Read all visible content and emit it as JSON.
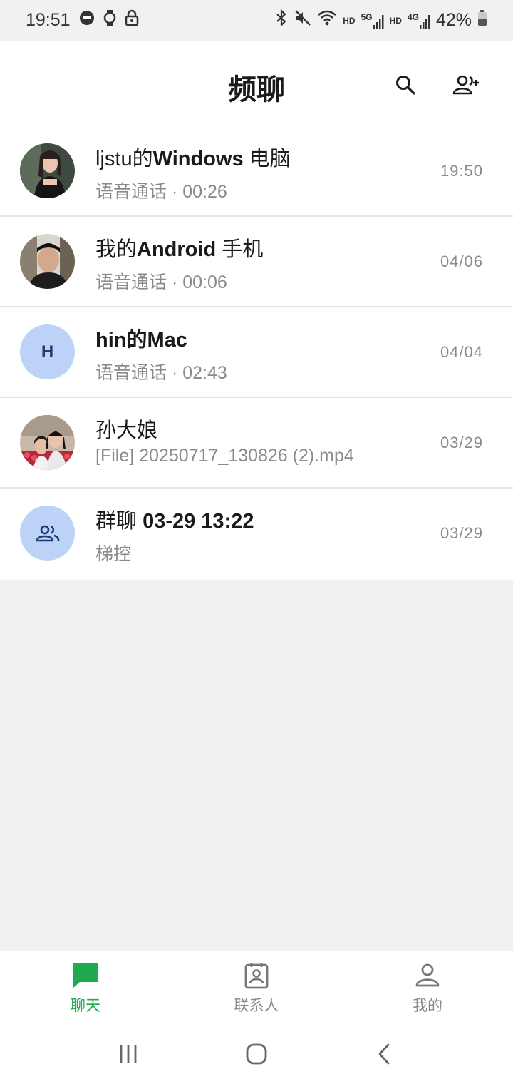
{
  "status_bar": {
    "time": "19:51",
    "left_icons": [
      "wear-icon",
      "watch-icon",
      "lock-icon"
    ],
    "network_hd1": "HD",
    "network_5g": "5G",
    "network_hd2": "HD",
    "network_4g": "4G",
    "battery": "42%"
  },
  "header": {
    "title": "频聊",
    "search_icon": "search-icon",
    "add_contact_icon": "add-contact-icon"
  },
  "chats": [
    {
      "avatar_type": "photo",
      "name_prefix": "ljstu的",
      "name_bold": "Windows",
      "name_suffix": " 电脑",
      "subtitle": "语音通话 · 00:26",
      "time": "19:50"
    },
    {
      "avatar_type": "photo",
      "name_prefix": "我的",
      "name_bold": "Android",
      "name_suffix": " 手机",
      "subtitle": "语音通话 · 00:06",
      "time": "04/06"
    },
    {
      "avatar_type": "letter",
      "avatar_letter": "H",
      "name_prefix": "",
      "name_bold": "hin",
      "name_suffix": "的Mac",
      "subtitle": "语音通话 · 02:43",
      "time": "04/04"
    },
    {
      "avatar_type": "photo",
      "name_prefix": "孙大娘",
      "name_bold": "",
      "name_suffix": "",
      "subtitle": "[File] 20250717_130826 (2).mp4",
      "time": "03/29"
    },
    {
      "avatar_type": "group",
      "name_prefix": "群聊 ",
      "name_bold": "03-29 13:22",
      "name_suffix": "",
      "subtitle": "梯控",
      "time": "03/29"
    }
  ],
  "bottom_nav": {
    "items": [
      {
        "label": "聊天",
        "icon": "chat-icon",
        "active": true
      },
      {
        "label": "联系人",
        "icon": "contacts-icon",
        "active": false
      },
      {
        "label": "我的",
        "icon": "profile-icon",
        "active": false
      }
    ]
  },
  "colors": {
    "accent": "#1faa4f",
    "avatar_bg": "#bcd3f7",
    "background": "#f1f1f1"
  }
}
